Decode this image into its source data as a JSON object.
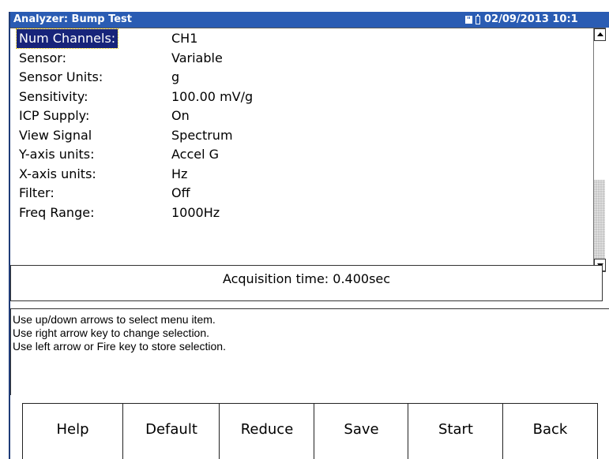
{
  "window": {
    "title": "Analyzer: Bump Test",
    "datetime": "02/09/2013 10:1",
    "icons": [
      "sd-card-icon",
      "battery-icon"
    ]
  },
  "settings": [
    {
      "label": "Num Channels:",
      "value": "CH1"
    },
    {
      "label": "Sensor:",
      "value": "Variable"
    },
    {
      "label": "Sensor Units:",
      "value": "g"
    },
    {
      "label": "Sensitivity:",
      "value": "100.00 mV/g"
    },
    {
      "label": "ICP Supply:",
      "value": "On"
    },
    {
      "label": "View Signal",
      "value": "Spectrum"
    },
    {
      "label": "Y-axis units:",
      "value": "Accel G"
    },
    {
      "label": "X-axis units:",
      "value": "Hz"
    },
    {
      "label": "Filter:",
      "value": "Off"
    },
    {
      "label": "Freq Range:",
      "value": "1000Hz"
    }
  ],
  "selected_index": 0,
  "acquisition": {
    "text": "Acquisition time: 0.400sec"
  },
  "help_lines": [
    "Use up/down arrows to select menu item.",
    "Use right arrow key to change selection.",
    "Use left arrow or Fire key to store selection."
  ],
  "softkeys": [
    "Help",
    "Default",
    "Reduce",
    "Save",
    "Start",
    "Back"
  ],
  "colors": {
    "titlebar": "#2a5cb3",
    "selection": "#17247a"
  }
}
